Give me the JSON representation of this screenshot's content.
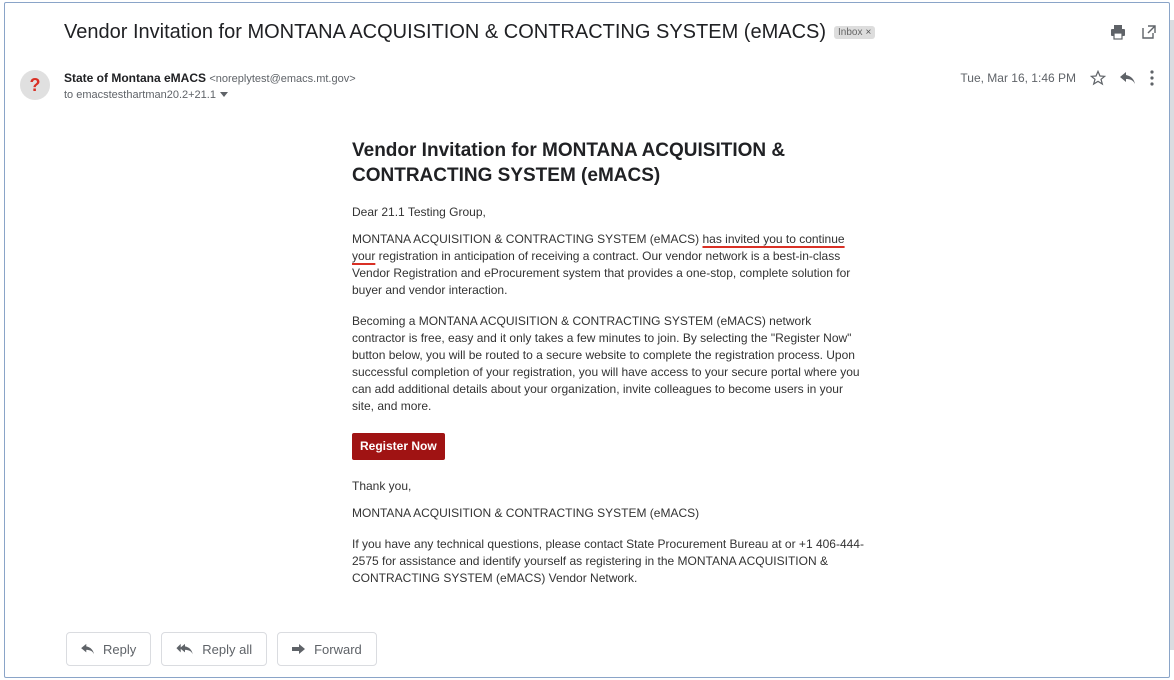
{
  "email": {
    "subject": "Vendor Invitation for MONTANA ACQUISITION & CONTRACTING SYSTEM (eMACS)",
    "label": "Inbox",
    "label_close": "×",
    "sender_name": "State of Montana eMACS",
    "sender_email": "<noreplytest@emacs.mt.gov>",
    "recipient": "to emacstesthartman20.2+21.1",
    "timestamp": "Tue, Mar 16, 1:46 PM"
  },
  "body": {
    "title": "Vendor Invitation for MONTANA ACQUISITION & CONTRACTING SYSTEM (eMACS)",
    "greeting": "Dear 21.1 Testing Group,",
    "p1_start": "MONTANA ACQUISITION & CONTRACTING SYSTEM (eMACS) ",
    "p1_underlined": "has invited you to continue your",
    "p1_end": " registration in anticipation of receiving a contract. Our vendor network is a best-in-class Vendor Registration and eProcurement system that provides a one-stop, complete solution for buyer and vendor interaction.",
    "p2": "Becoming a MONTANA ACQUISITION & CONTRACTING SYSTEM (eMACS) network contractor is free, easy and it only takes a few minutes to join. By selecting the \"Register Now\" button below, you will be routed to a secure website to complete the registration process. Upon successful completion of your registration, you will have access to your secure portal where you can add additional details about your organization, invite colleagues to become users in your site, and more.",
    "register_label": "Register Now",
    "thanks": "Thank you,",
    "signature": "MONTANA ACQUISITION & CONTRACTING SYSTEM (eMACS)",
    "support": "If you have any technical questions, please contact State Procurement Bureau  at  or +1 406-444-2575 for assistance and identify yourself as registering in the MONTANA ACQUISITION & CONTRACTING SYSTEM (eMACS) Vendor Network."
  },
  "actions": {
    "reply": "Reply",
    "reply_all": "Reply all",
    "forward": "Forward"
  },
  "icons": {
    "avatar_glyph": "?"
  },
  "colors": {
    "register_button": "#a01313",
    "underline": "#d93025"
  }
}
